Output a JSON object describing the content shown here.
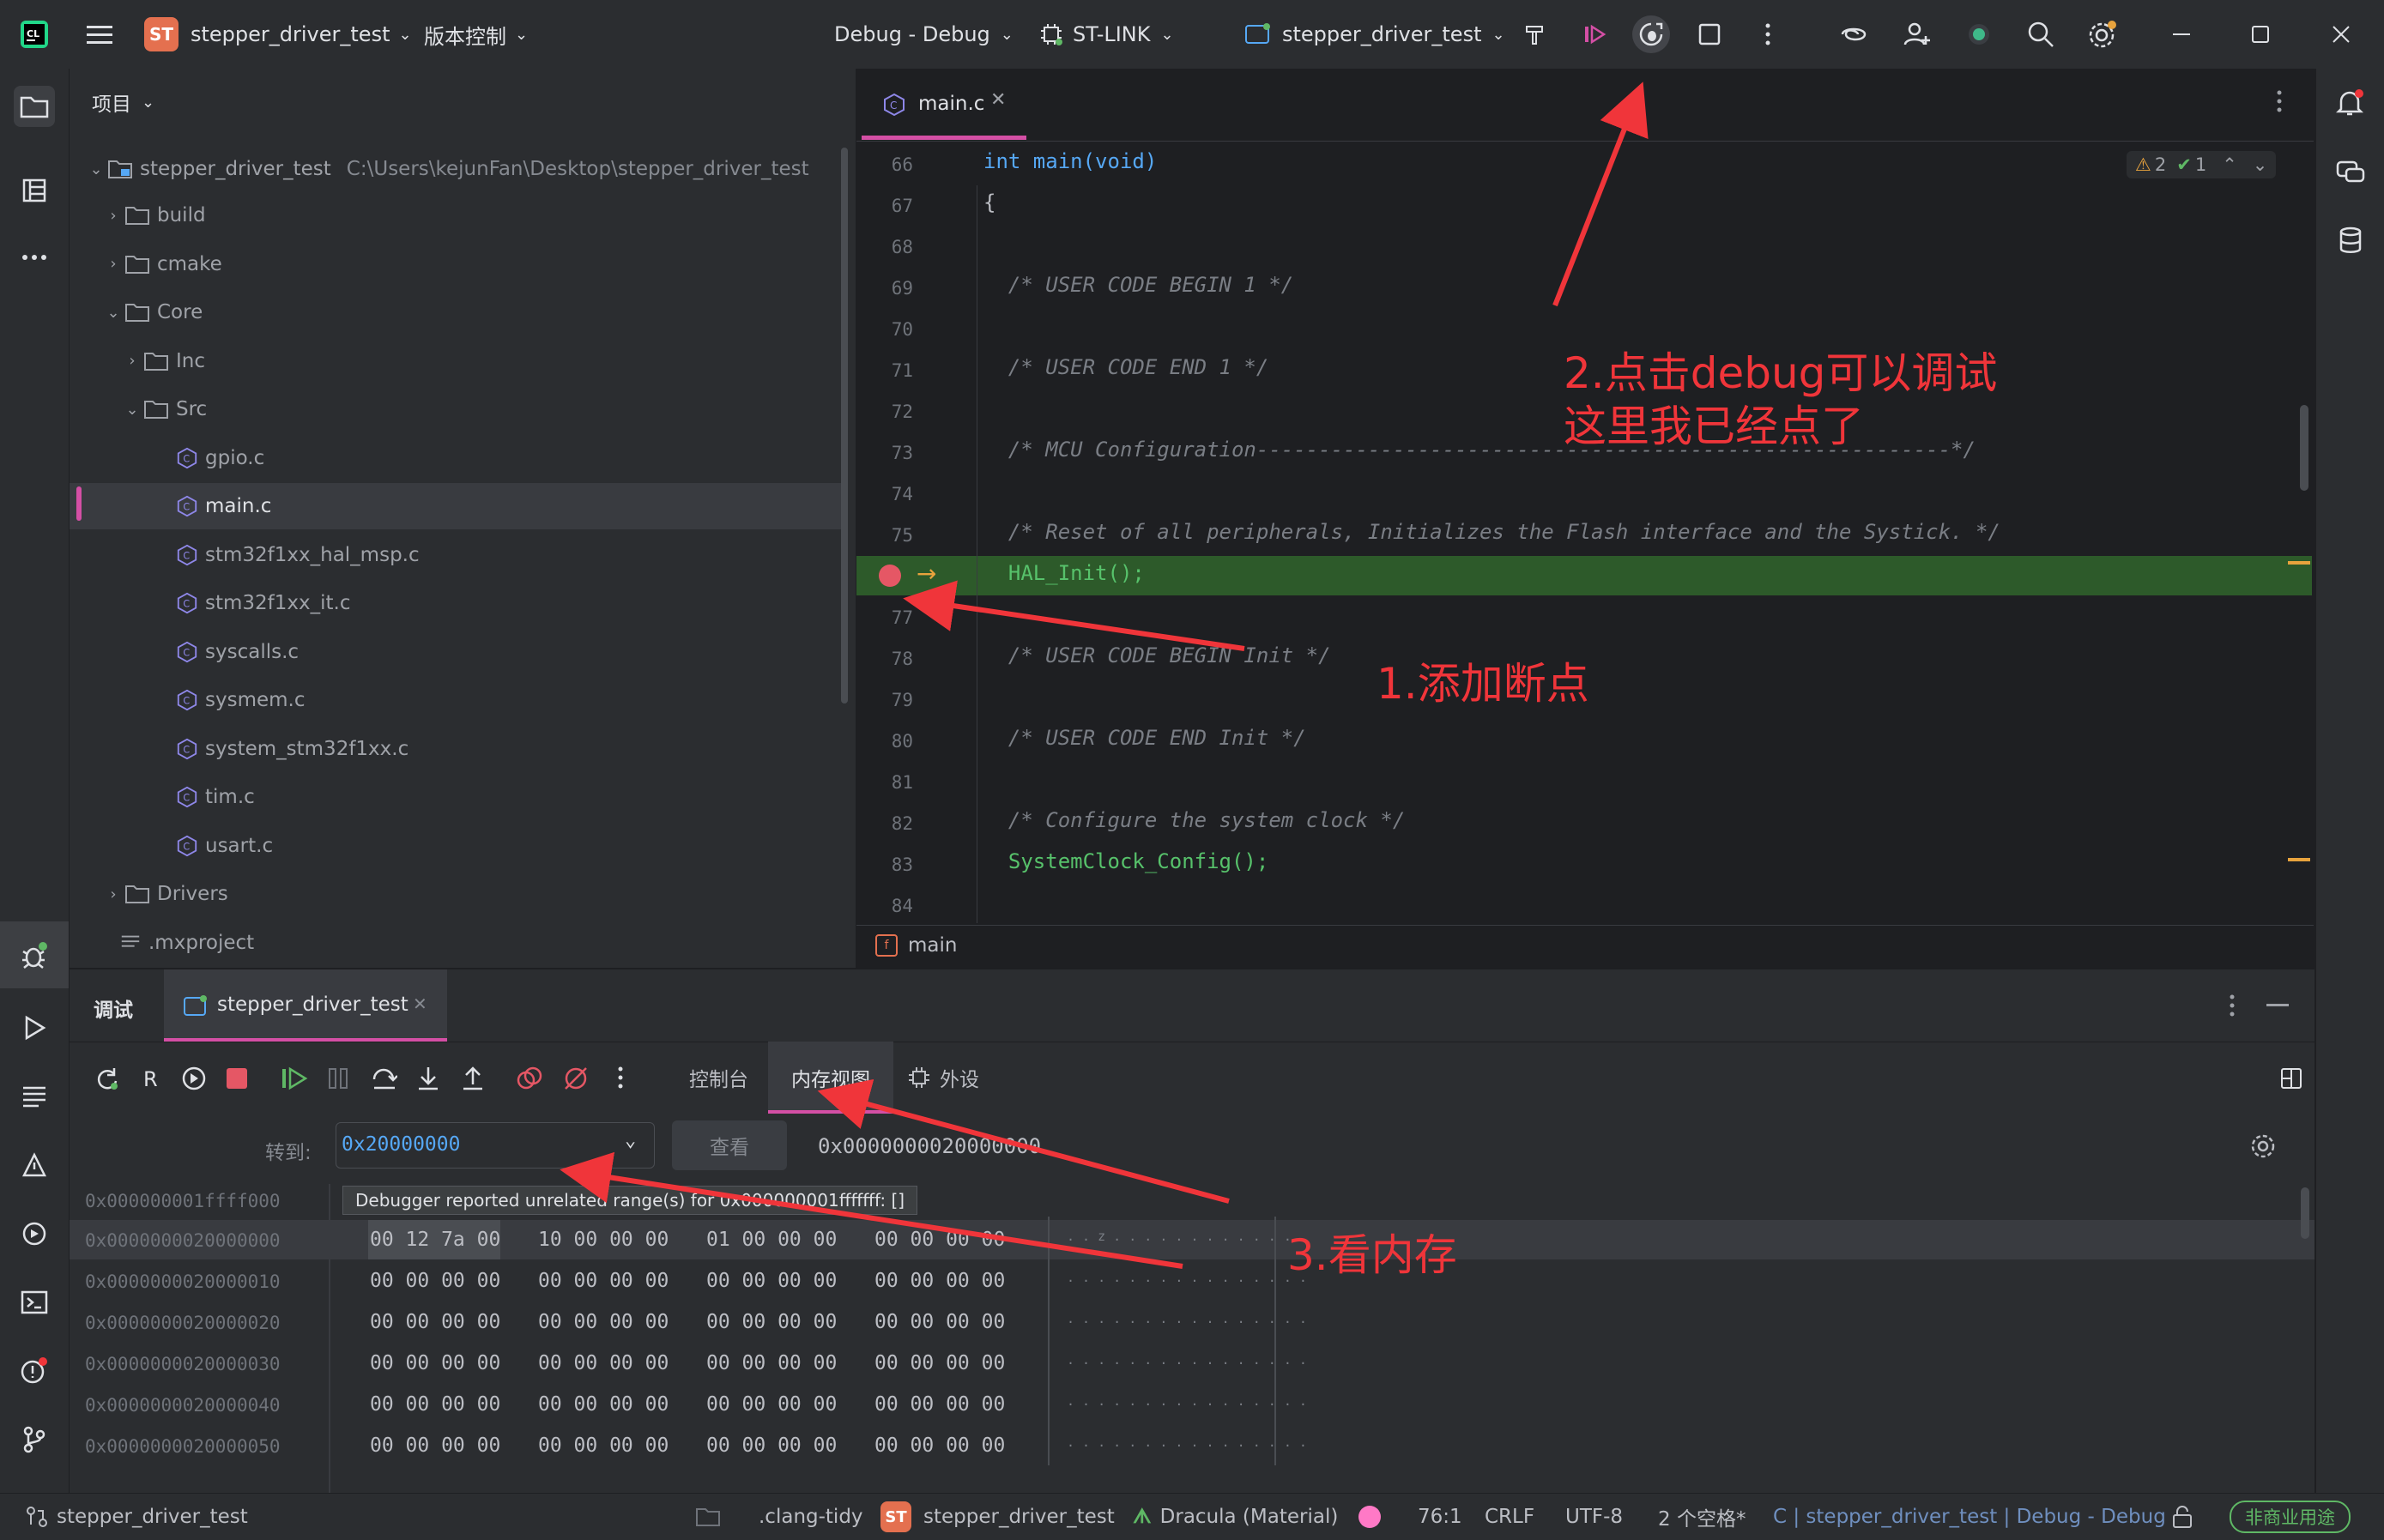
{
  "titlebar": {
    "project_badge": "ST",
    "project_name": "stepper_driver_test",
    "vcs_label": "版本控制",
    "run_config": "Debug - Debug",
    "debugger": "ST-LINK",
    "target": "stepper_driver_test"
  },
  "project_panel": {
    "title": "项目",
    "root_name": "stepper_driver_test",
    "root_path": "C:\\Users\\kejunFan\\Desktop\\stepper_driver_test",
    "tree": [
      {
        "label": "build",
        "type": "folder",
        "level": 1,
        "expanded": false
      },
      {
        "label": "cmake",
        "type": "folder",
        "level": 1,
        "expanded": false
      },
      {
        "label": "Core",
        "type": "folder",
        "level": 1,
        "expanded": true
      },
      {
        "label": "Inc",
        "type": "folder",
        "level": 2,
        "expanded": false
      },
      {
        "label": "Src",
        "type": "folder",
        "level": 2,
        "expanded": true
      },
      {
        "label": "gpio.c",
        "type": "c-file",
        "level": 3
      },
      {
        "label": "main.c",
        "type": "c-file",
        "level": 3,
        "selected": true
      },
      {
        "label": "stm32f1xx_hal_msp.c",
        "type": "c-file",
        "level": 3
      },
      {
        "label": "stm32f1xx_it.c",
        "type": "c-file",
        "level": 3
      },
      {
        "label": "syscalls.c",
        "type": "c-file",
        "level": 3
      },
      {
        "label": "sysmem.c",
        "type": "c-file",
        "level": 3
      },
      {
        "label": "system_stm32f1xx.c",
        "type": "c-file",
        "level": 3
      },
      {
        "label": "tim.c",
        "type": "c-file",
        "level": 3
      },
      {
        "label": "usart.c",
        "type": "c-file",
        "level": 3
      },
      {
        "label": "Drivers",
        "type": "folder",
        "level": 1,
        "expanded": false
      },
      {
        "label": ".mxproject",
        "type": "text-file",
        "level": 1
      }
    ]
  },
  "editor": {
    "tab_label": "main.c",
    "warnings_count": "2",
    "ok_count": "1",
    "breadcrumb_function": "main",
    "lines": [
      {
        "num": "66",
        "text": "int main(void)",
        "kind": "signature"
      },
      {
        "num": "67",
        "text": "{",
        "kind": "plain"
      },
      {
        "num": "68",
        "text": "",
        "kind": "plain"
      },
      {
        "num": "69",
        "text": "  /* USER CODE BEGIN 1 */",
        "kind": "comment"
      },
      {
        "num": "70",
        "text": "",
        "kind": "plain"
      },
      {
        "num": "71",
        "text": "  /* USER CODE END 1 */",
        "kind": "comment"
      },
      {
        "num": "72",
        "text": "",
        "kind": "plain"
      },
      {
        "num": "73",
        "text": "  /* MCU Configuration--------------------------------------------------------*/",
        "kind": "comment"
      },
      {
        "num": "74",
        "text": "",
        "kind": "plain"
      },
      {
        "num": "75",
        "text": "  /* Reset of all peripherals, Initializes the Flash interface and the Systick. */",
        "kind": "comment"
      },
      {
        "num": "",
        "text": "  HAL_Init();",
        "kind": "current"
      },
      {
        "num": "77",
        "text": "",
        "kind": "plain"
      },
      {
        "num": "78",
        "text": "  /* USER CODE BEGIN Init */",
        "kind": "comment"
      },
      {
        "num": "79",
        "text": "",
        "kind": "plain"
      },
      {
        "num": "80",
        "text": "  /* USER CODE END Init */",
        "kind": "comment"
      },
      {
        "num": "81",
        "text": "",
        "kind": "plain"
      },
      {
        "num": "82",
        "text": "  /* Configure the system clock */",
        "kind": "comment"
      },
      {
        "num": "83",
        "text": "  SystemClock_Config();",
        "kind": "call"
      },
      {
        "num": "84",
        "text": "",
        "kind": "plain"
      }
    ]
  },
  "debug_panel": {
    "title": "调试",
    "session_tab": "stepper_driver_test",
    "tabs": [
      "控制台",
      "内存视图",
      "外设"
    ],
    "active_tab": "内存视图",
    "goto_label": "转到:",
    "goto_value": "0x20000000",
    "view_button": "查看",
    "current_address": "0x0000000020000000",
    "tooltip": "Debugger reported unrelated range(s) for 0x000000001fffffff: []",
    "prev_address": "0x000000001ffff000",
    "rows": [
      {
        "addr": "0x0000000020000000",
        "g1": "00 12 7a 00",
        "g2": "10 00 00 00",
        "g3": "01 00 00 00",
        "g4": "00 00 00 00",
        "ascii": ". . z . . . . . . . . . . . . ."
      },
      {
        "addr": "0x0000000020000010",
        "g1": "00 00 00 00",
        "g2": "00 00 00 00",
        "g3": "00 00 00 00",
        "g4": "00 00 00 00",
        "ascii": ". . . . . . . . . . . . . . . ."
      },
      {
        "addr": "0x0000000020000020",
        "g1": "00 00 00 00",
        "g2": "00 00 00 00",
        "g3": "00 00 00 00",
        "g4": "00 00 00 00",
        "ascii": ". . . . . . . . . . . . . . . ."
      },
      {
        "addr": "0x0000000020000030",
        "g1": "00 00 00 00",
        "g2": "00 00 00 00",
        "g3": "00 00 00 00",
        "g4": "00 00 00 00",
        "ascii": ". . . . . . . . . . . . . . . ."
      },
      {
        "addr": "0x0000000020000040",
        "g1": "00 00 00 00",
        "g2": "00 00 00 00",
        "g3": "00 00 00 00",
        "g4": "00 00 00 00",
        "ascii": ". . . . . . . . . . . . . . . ."
      },
      {
        "addr": "0x0000000020000050",
        "g1": "00 00 00 00",
        "g2": "00 00 00 00",
        "g3": "00 00 00 00",
        "g4": "00 00 00 00",
        "ascii": ". . . . . . . . . . . . . . . ."
      }
    ]
  },
  "annotations": {
    "step1": "1.添加断点",
    "step2_line1": "2.点击debug可以调试",
    "step2_line2": "这里我已经点了",
    "step3": "3.看内存"
  },
  "statusbar": {
    "project": "stepper_driver_test",
    "clang_tidy": ".clang-tidy",
    "badge": "ST",
    "target": "stepper_driver_test",
    "theme": "Dracula (Material)",
    "position": "76:1",
    "line_ending": "CRLF",
    "encoding": "UTF-8",
    "indent": "2 个空格*",
    "context": "C | stepper_driver_test | Debug - Debug",
    "license": "非商业用途"
  },
  "colors": {
    "accent": "#d44fa5",
    "annotation": "#f0353a",
    "current_line": "#2d5a2a"
  }
}
